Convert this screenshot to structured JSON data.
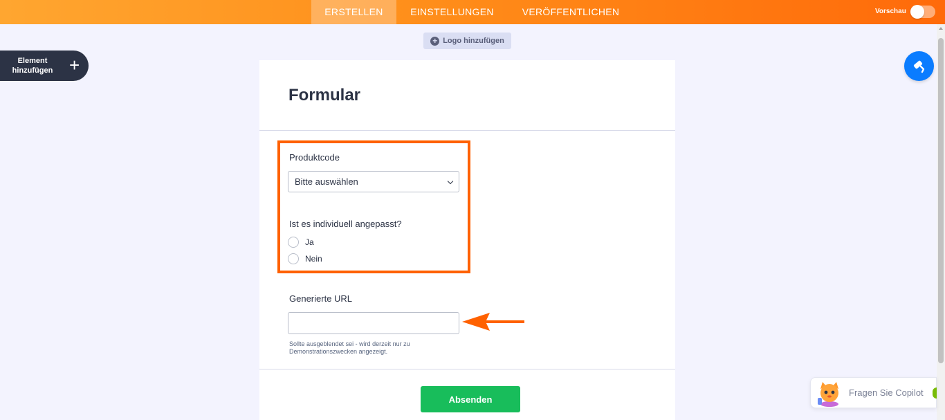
{
  "topbar": {
    "tabs": [
      {
        "label": "ERSTELLEN",
        "active": true
      },
      {
        "label": "EINSTELLUNGEN",
        "active": false
      },
      {
        "label": "VERÖFFENTLICHEN",
        "active": false
      }
    ],
    "preview_label": "Vorschau"
  },
  "toolbar": {
    "logo_label": "Logo hinzufügen",
    "add_element_label": "Element hinzufügen"
  },
  "form": {
    "title": "Formular",
    "product_code": {
      "label": "Produktcode",
      "selected": "Bitte auswählen"
    },
    "customized": {
      "label": "Ist es individuell angepasst?",
      "options": [
        "Ja",
        "Nein"
      ]
    },
    "generated_url": {
      "label": "Generierte URL",
      "value": "",
      "sublabel": "Sollte ausgeblendet sei - wird derzeit nur zu Demonstrationszwecken angezeigt."
    },
    "submit_label": "Absenden"
  },
  "copilot": {
    "label": "Fragen Sie Copilot"
  },
  "colors": {
    "accent_orange": "#ff6100",
    "designer_blue": "#0a7cff",
    "submit_green": "#18bd5b",
    "dark_navy": "#2c3345"
  }
}
